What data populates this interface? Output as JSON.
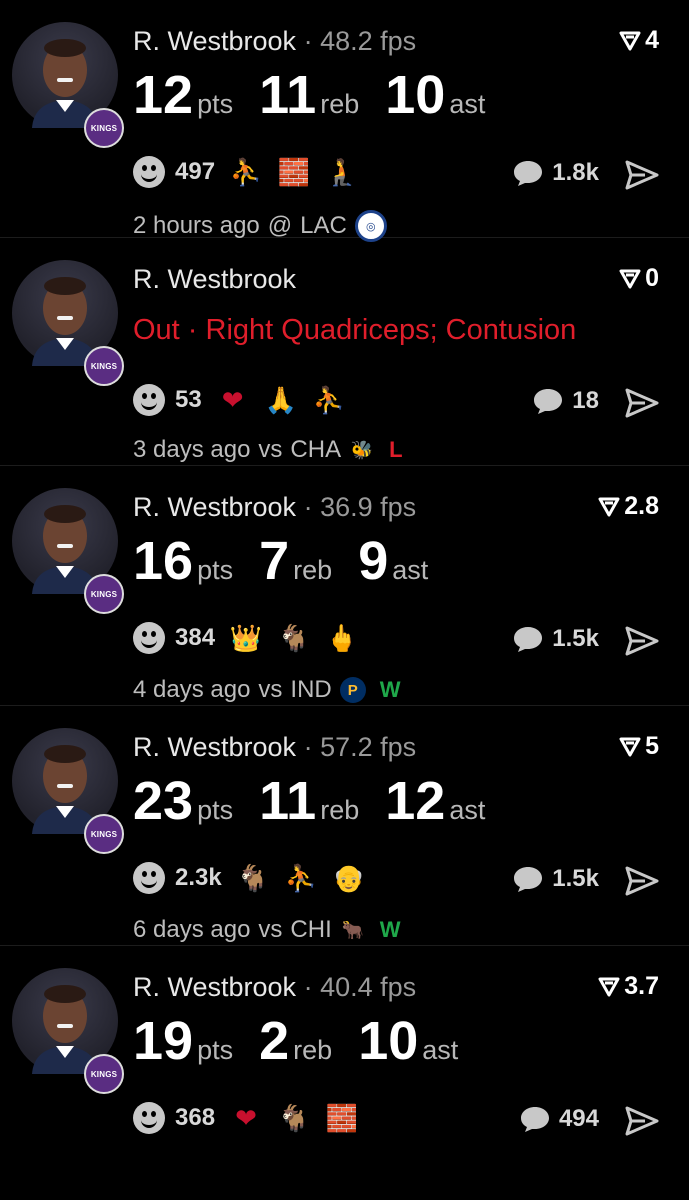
{
  "posts": [
    {
      "player": "R. Westbrook",
      "separator": "·",
      "fps": "48.2 fps",
      "rating": "4",
      "stats": [
        {
          "value": "12",
          "unit": "pts"
        },
        {
          "value": "11",
          "unit": "reb"
        },
        {
          "value": "10",
          "unit": "ast"
        }
      ],
      "reaction_count": "497",
      "reaction_emojis": [
        "player-emoji",
        "brick-emoji",
        "man-kneeling-emoji"
      ],
      "comments": "1.8k",
      "time": "2 hours ago",
      "opponent_prefix": "@",
      "opponent": "LAC",
      "team_logo": "clippers-logo"
    },
    {
      "player": "R. Westbrook",
      "rating": "0",
      "injury": "Out · Right Quadriceps; Contusion",
      "reaction_count": "53",
      "reaction_emojis": [
        "heart-emoji",
        "folded-hands-emoji",
        "player-emoji"
      ],
      "comments": "18",
      "time": "3 days ago",
      "opponent_prefix": "vs",
      "opponent": "CHA",
      "team_logo": "hornets-logo",
      "result": "L"
    },
    {
      "player": "R. Westbrook",
      "separator": "·",
      "fps": "36.9 fps",
      "rating": "2.8",
      "stats": [
        {
          "value": "16",
          "unit": "pts"
        },
        {
          "value": "7",
          "unit": "reb"
        },
        {
          "value": "9",
          "unit": "ast"
        }
      ],
      "reaction_count": "384",
      "reaction_emojis": [
        "crown-emoji",
        "goat-emoji",
        "middle-finger-emoji"
      ],
      "comments": "1.5k",
      "time": "4 days ago",
      "opponent_prefix": "vs",
      "opponent": "IND",
      "team_logo": "pacers-logo",
      "result": "W"
    },
    {
      "player": "R. Westbrook",
      "separator": "·",
      "fps": "57.2 fps",
      "rating": "5",
      "stats": [
        {
          "value": "23",
          "unit": "pts"
        },
        {
          "value": "11",
          "unit": "reb"
        },
        {
          "value": "12",
          "unit": "ast"
        }
      ],
      "reaction_count": "2.3k",
      "reaction_emojis": [
        "goat-emoji",
        "player-emoji",
        "old-man-emoji"
      ],
      "comments": "1.5k",
      "time": "6 days ago",
      "opponent_prefix": "vs",
      "opponent": "CHI",
      "team_logo": "bulls-logo",
      "result": "W"
    },
    {
      "player": "R. Westbrook",
      "separator": "·",
      "fps": "40.4 fps",
      "rating": "3.7",
      "stats": [
        {
          "value": "19",
          "unit": "pts"
        },
        {
          "value": "2",
          "unit": "reb"
        },
        {
          "value": "10",
          "unit": "ast"
        }
      ],
      "reaction_count": "368",
      "reaction_emojis": [
        "heart-emoji",
        "goat-emoji",
        "brick-emoji"
      ],
      "comments": "494"
    }
  ],
  "badge_text": "KINGS",
  "colors": {
    "background": "#000000",
    "injury_red": "#e01e2b",
    "loss_red": "#e01e2b",
    "win_green": "#1fa84a",
    "team_purple": "#5a2d82"
  }
}
